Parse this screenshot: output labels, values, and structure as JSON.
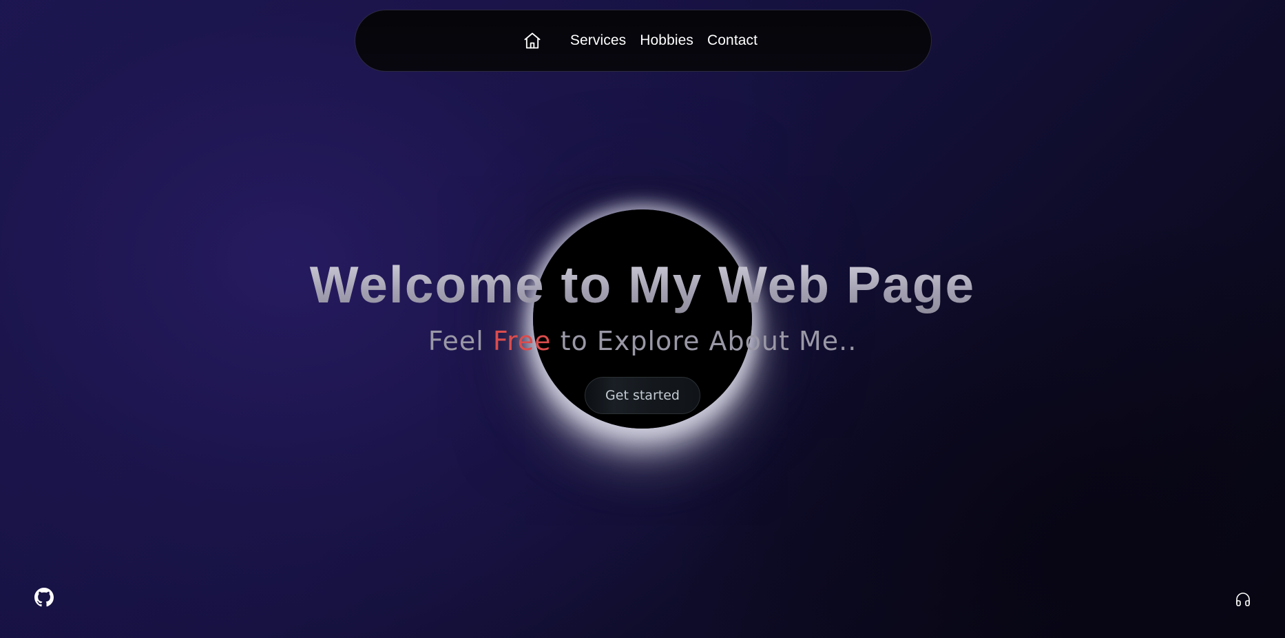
{
  "nav": {
    "home_icon": "home-icon",
    "links": [
      "Services",
      "Hobbies",
      "Contact"
    ]
  },
  "hero": {
    "title": "Welcome to My Web Page",
    "subtitle_prefix": "Feel ",
    "subtitle_accent": "Free",
    "subtitle_suffix": " to Explore About Me..",
    "cta_label": "Get started"
  },
  "footer": {
    "left_icon": "github-icon",
    "right_icon": "headphones-icon"
  },
  "colors": {
    "accent": "#dc4c4c",
    "background": "#15113e",
    "nav_background": "#060509"
  }
}
